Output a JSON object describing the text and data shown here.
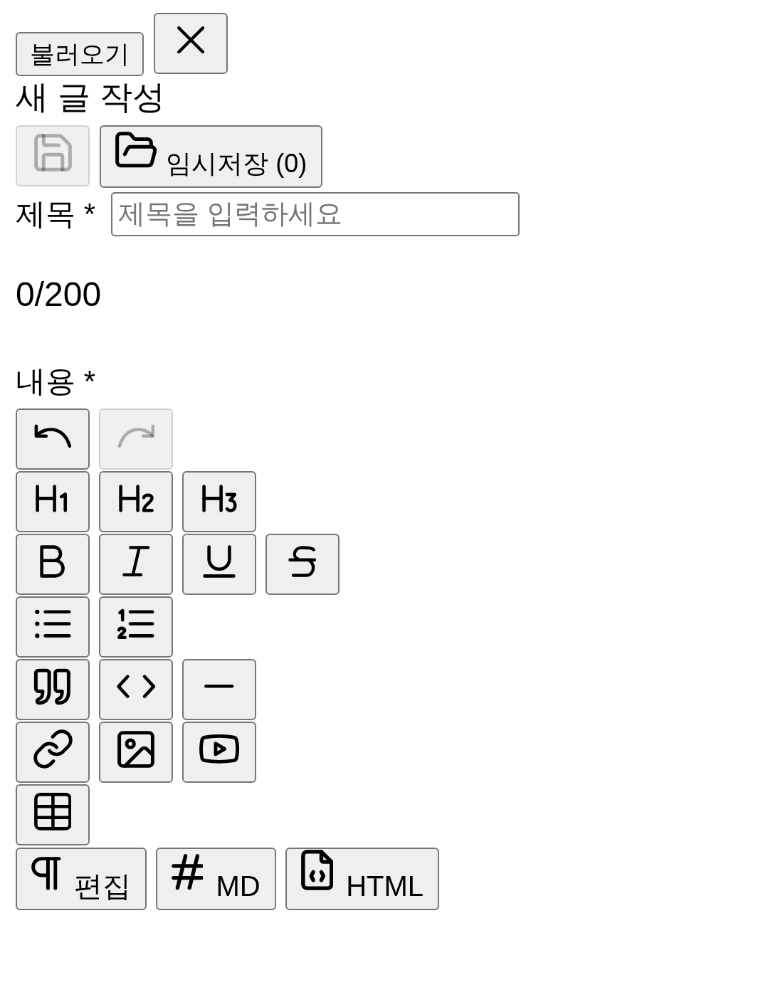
{
  "top_bar": {
    "load_button": {
      "label": "불러오기"
    }
  },
  "heading": "새 글 작성",
  "draft_bar": {
    "save_button": {
      "disabled": true
    },
    "drafts_button": {
      "label": "임시저장 (0)"
    }
  },
  "title_field": {
    "label": "제목 *",
    "placeholder": "제목을 입력하세요",
    "counter": "0/200"
  },
  "content": {
    "label": "내용 *",
    "toolbar_rows": [
      {
        "tools": [
          {
            "kind": "undo",
            "disabled": false
          },
          {
            "kind": "redo",
            "disabled": true
          }
        ]
      },
      {
        "tools": [
          {
            "kind": "h1",
            "disabled": false
          },
          {
            "kind": "h2",
            "disabled": false
          },
          {
            "kind": "h3",
            "disabled": false
          }
        ]
      },
      {
        "tools": [
          {
            "kind": "bold",
            "disabled": false
          },
          {
            "kind": "italic",
            "disabled": false
          },
          {
            "kind": "underline",
            "disabled": false
          },
          {
            "kind": "strike",
            "disabled": false
          }
        ]
      },
      {
        "tools": [
          {
            "kind": "bullet_list",
            "disabled": false
          },
          {
            "kind": "ordered_list",
            "disabled": false
          }
        ]
      },
      {
        "tools": [
          {
            "kind": "quote",
            "disabled": false
          },
          {
            "kind": "code",
            "disabled": false
          },
          {
            "kind": "divider",
            "disabled": false
          }
        ]
      },
      {
        "tools": [
          {
            "kind": "link",
            "disabled": false
          },
          {
            "kind": "image",
            "disabled": false
          },
          {
            "kind": "video",
            "disabled": false
          }
        ]
      },
      {
        "tools": [
          {
            "kind": "table",
            "disabled": false
          }
        ]
      }
    ],
    "mode_buttons": [
      {
        "kind": "edit",
        "label": "편집"
      },
      {
        "kind": "markdown",
        "label": "MD"
      },
      {
        "kind": "html",
        "label": "HTML"
      }
    ]
  }
}
